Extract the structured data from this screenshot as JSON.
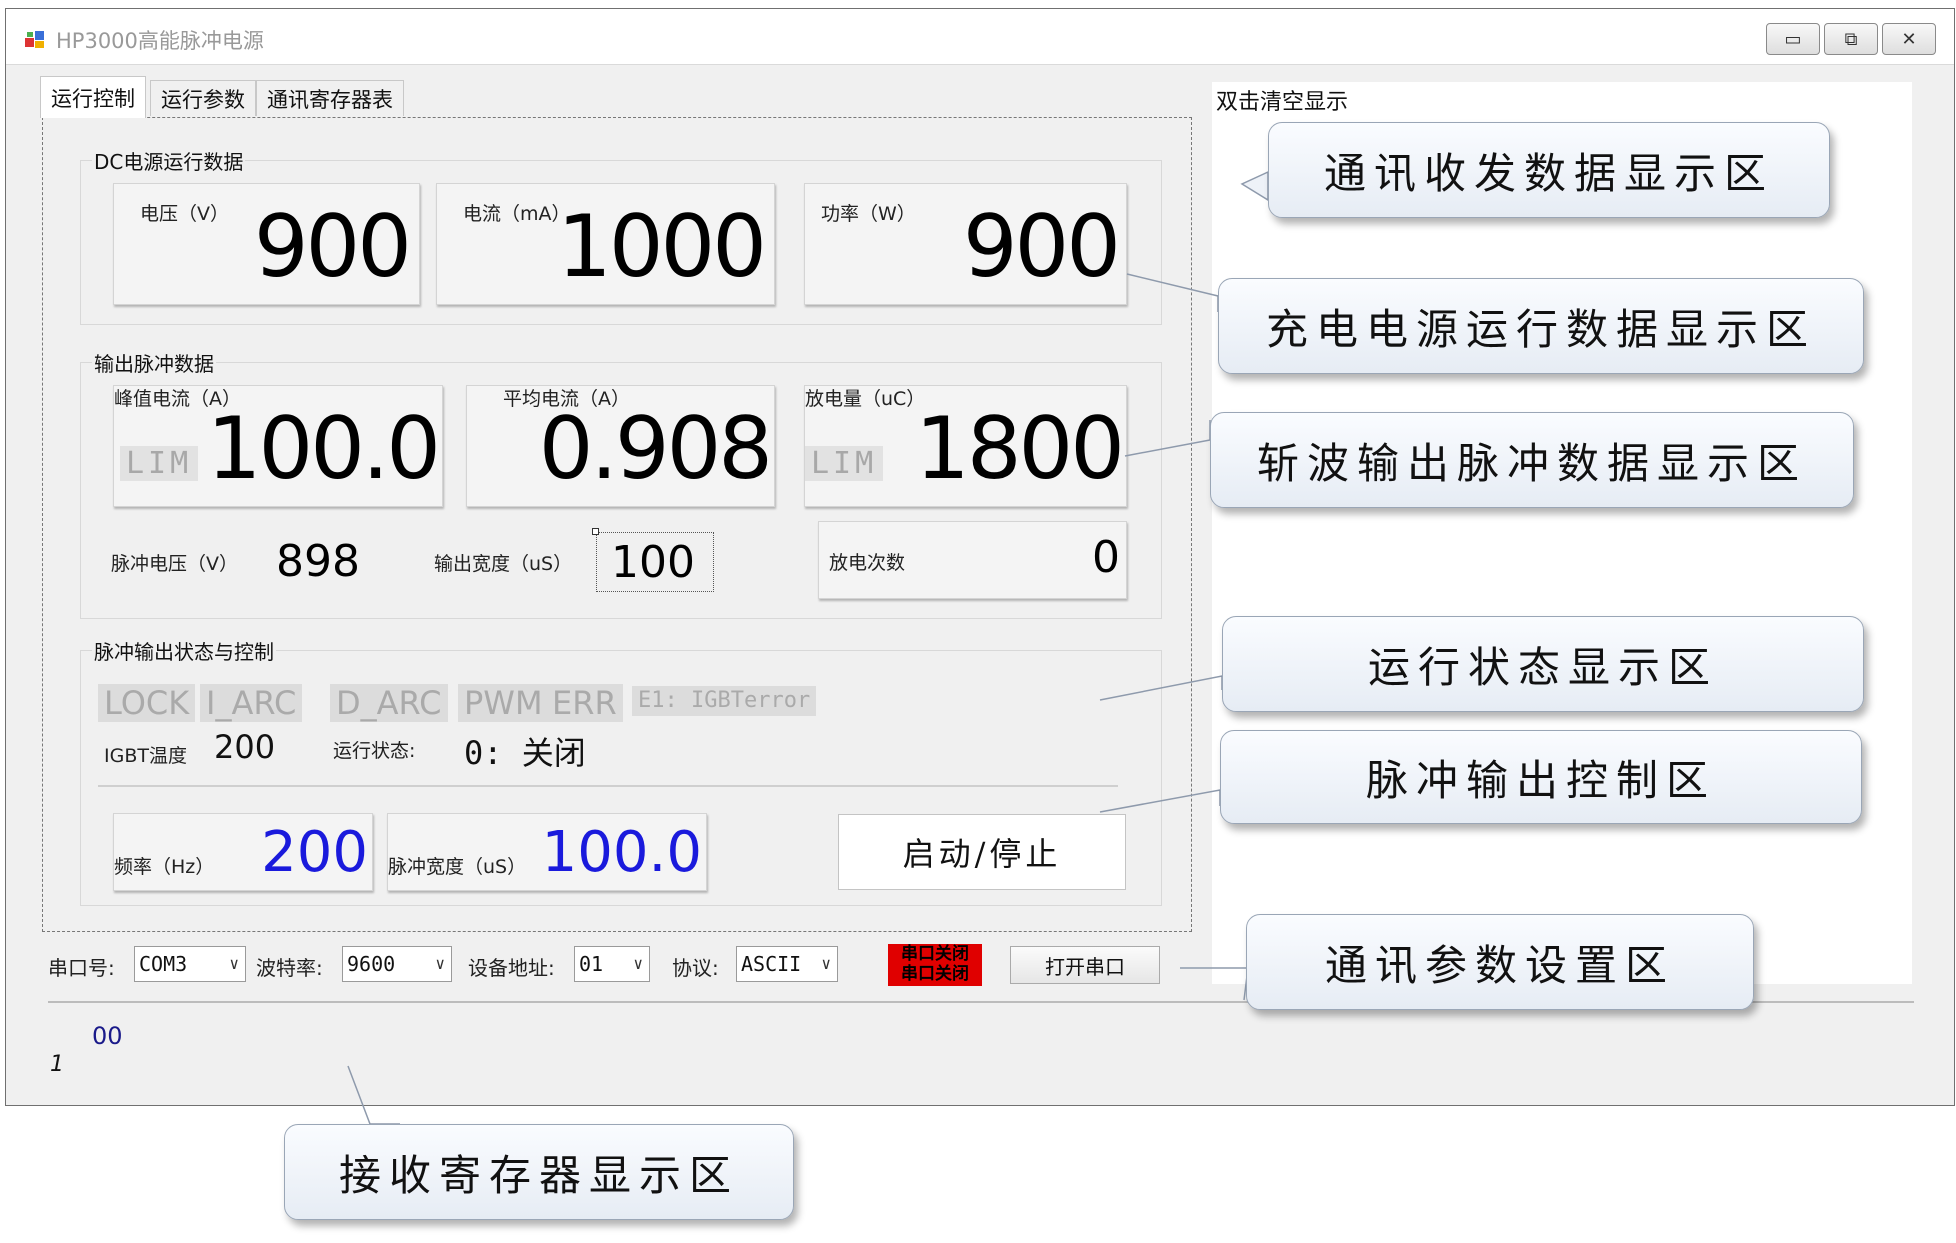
{
  "window": {
    "title": "HP3000高能脉冲电源",
    "minimize": "▭",
    "maximize": "⧉",
    "close": "✕"
  },
  "tabs": [
    {
      "label": "运行控制"
    },
    {
      "label": "运行参数"
    },
    {
      "label": "通讯寄存器表"
    }
  ],
  "dc_group": {
    "title": "DC电源运行数据",
    "voltage": {
      "label": "电压（V）",
      "value": "900"
    },
    "current": {
      "label": "电流（mA）",
      "value": "1000"
    },
    "power": {
      "label": "功率（W）",
      "value": "900"
    }
  },
  "pulse_group": {
    "title": "输出脉冲数据",
    "peak_current": {
      "label": "峰值电流（A）",
      "lim": "LIM",
      "value": "100.0"
    },
    "avg_current": {
      "label": "平均电流（A）",
      "value": "0.908"
    },
    "discharge": {
      "label": "放电量（uC）",
      "lim": "LIM",
      "value": "1800"
    },
    "pulse_voltage": {
      "label": "脉冲电压（V）",
      "value": "898"
    },
    "output_width": {
      "label": "输出宽度（uS）",
      "value": "100"
    },
    "discharge_count": {
      "label": "放电次数",
      "value": "0"
    }
  },
  "control_group": {
    "title": "脉冲输出状态与控制",
    "status_flags": [
      "LOCK",
      "I_ARC",
      "D_ARC",
      "PWM",
      "ERR",
      "E1: IGBTerror"
    ],
    "igbt_temp": {
      "label": "IGBT温度",
      "value": "200"
    },
    "run_state": {
      "label": "运行状态:",
      "value": "0: 关闭"
    },
    "frequency": {
      "label": "频率（Hz）",
      "value": "200"
    },
    "pulse_width": {
      "label": "脉冲宽度（uS）",
      "value": "100.0"
    },
    "start_stop": "启动/停止"
  },
  "comm_bar": {
    "port_label": "串口号:",
    "port_value": "COM3",
    "baud_label": "波特率:",
    "baud_value": "9600",
    "addr_label": "设备地址:",
    "addr_value": "01",
    "protocol_label": "协议:",
    "protocol_value": "ASCII",
    "port_status_line1": "串口关闭",
    "port_status_line2": "串口关闭",
    "open_button": "打开串口"
  },
  "log_panel": {
    "hint": "双击清空显示"
  },
  "register_display": {
    "value": "00",
    "index": "1"
  },
  "callouts": {
    "comm_data": "通讯收发数据显示区",
    "charge_data": "充电电源运行数据显示区",
    "chopper_data": "斩波输出脉冲数据显示区",
    "run_state": "运行状态显示区",
    "pulse_control": "脉冲输出控制区",
    "comm_settings": "通讯参数设置区",
    "register": "接收寄存器显示区"
  },
  "colors": {
    "setpoint_blue": "#1a1adc",
    "port_closed_red": "#e00000",
    "status_inactive": "#dcdcdc"
  }
}
